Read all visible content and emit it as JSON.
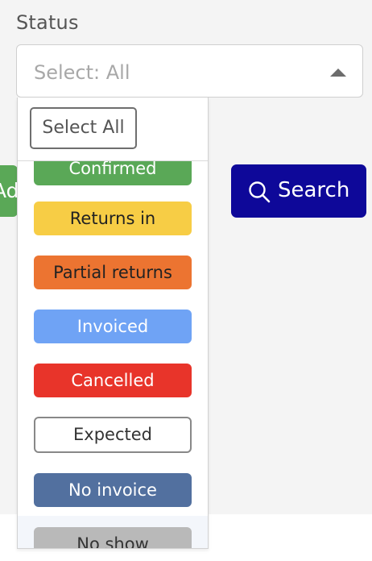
{
  "filter": {
    "label": "Status",
    "select_value": "Select: All",
    "select_all_label": "Select All"
  },
  "buttons": {
    "add_partial": "Ad",
    "search_label": "Search"
  },
  "status_options": [
    {
      "label": "Confirmed",
      "bg": "#5aa857",
      "fg": "#ffffff",
      "border": "none"
    },
    {
      "label": "Returns in",
      "bg": "#f7cd45",
      "fg": "#222222",
      "border": "none"
    },
    {
      "label": "Partial returns",
      "bg": "#ec7431",
      "fg": "#222222",
      "border": "none"
    },
    {
      "label": "Invoiced",
      "bg": "#6fa3f5",
      "fg": "#ffffff",
      "border": "none"
    },
    {
      "label": "Cancelled",
      "bg": "#e8342a",
      "fg": "#ffffff",
      "border": "none"
    },
    {
      "label": "Expected",
      "bg": "#ffffff",
      "fg": "#333333",
      "border": "#888888"
    },
    {
      "label": "No invoice",
      "bg": "#52709f",
      "fg": "#ffffff",
      "border": "none"
    },
    {
      "label": "No show",
      "bg": "#b9b9b9",
      "fg": "#333333",
      "border": "none"
    }
  ],
  "colors": {
    "search_button": "#0e0899",
    "add_button": "#5aa857"
  }
}
